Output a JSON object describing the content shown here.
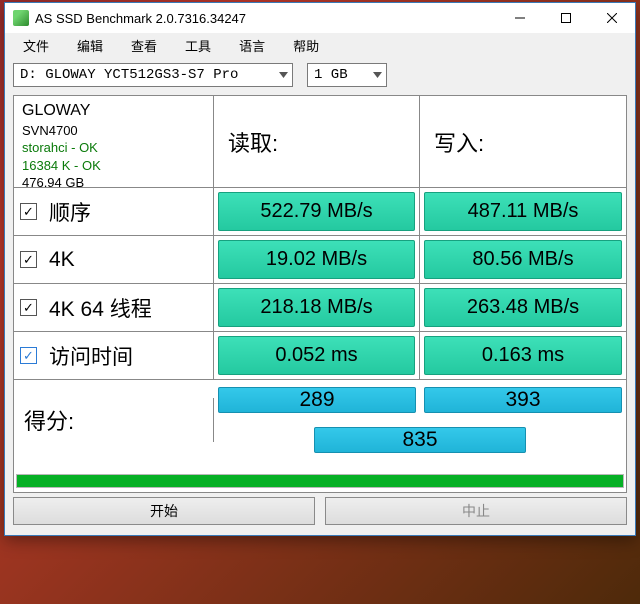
{
  "titlebar": {
    "title": "AS SSD Benchmark 2.0.7316.34247"
  },
  "menu": {
    "file": "文件",
    "edit": "编辑",
    "view": "查看",
    "tools": "工具",
    "language": "语言",
    "help": "帮助"
  },
  "selectors": {
    "drive": "D: GLOWAY YCT512GS3-S7 Pro",
    "size": "1 GB"
  },
  "info": {
    "name": "GLOWAY",
    "firmware": "SVN4700",
    "driver": "storahci - OK",
    "align": "16384 K - OK",
    "capacity": "476.94 GB"
  },
  "headers": {
    "read": "读取:",
    "write": "写入:"
  },
  "rows": {
    "seq": {
      "label": "顺序",
      "read": "522.79 MB/s",
      "write": "487.11 MB/s"
    },
    "fourk": {
      "label": "4K",
      "read": "19.02 MB/s",
      "write": "80.56 MB/s"
    },
    "fk64": {
      "label": "4K 64 线程",
      "read": "218.18 MB/s",
      "write": "263.48 MB/s"
    },
    "access": {
      "label": "访问时间",
      "read": "0.052 ms",
      "write": "0.163 ms"
    }
  },
  "score": {
    "label": "得分:",
    "read": "289",
    "write": "393",
    "total": "835"
  },
  "buttons": {
    "start": "开始",
    "abort": "中止"
  }
}
